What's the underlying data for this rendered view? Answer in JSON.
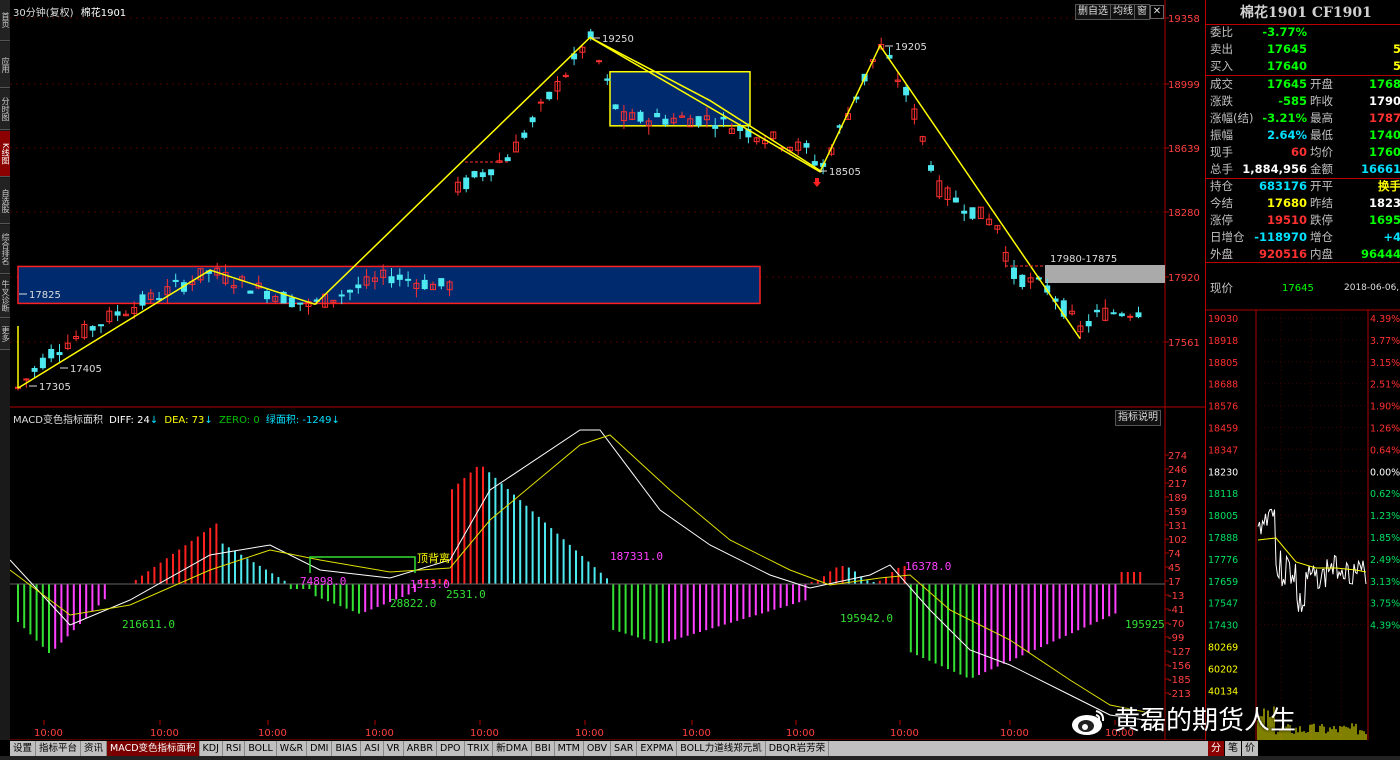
{
  "toolbar_left": [
    "首页",
    "应用",
    "分时图",
    "K线图",
    "自选股",
    "综合排名",
    "牛叉诊断",
    "更多"
  ],
  "chart": {
    "period_label": "30分钟(复权)",
    "symbol": "棉花1901",
    "buttons": [
      "删自选",
      "均线",
      "窗"
    ],
    "price_axis": [
      "19358",
      "18999",
      "18639",
      "18280",
      "17920",
      "17561"
    ],
    "annotations": {
      "hi1": "19250",
      "hi2": "19205",
      "lo1": "17305",
      "lo2": "17405",
      "lvl1": "17825",
      "lo3": "18505",
      "zone": "17980-17875"
    },
    "time_labels": [
      "10:00",
      "10:00",
      "10:00",
      "10:00",
      "10:00",
      "10:00",
      "10:00",
      "10:00",
      "10:00",
      "10:00",
      "10:00"
    ]
  },
  "macd": {
    "title": "MACD变色指标面积",
    "diff_label": "DIFF: 24",
    "dea_label": "DEA: 73",
    "zero_label": "ZERO: 0",
    "area_label": "绿面积: -1249",
    "help_button": "指标说明",
    "axis": [
      "274",
      "246",
      "217",
      "189",
      "159",
      "131",
      "102",
      "74",
      "45",
      "17",
      "-13",
      "-41",
      "-70",
      "-99",
      "-127",
      "-156",
      "-185",
      "-213"
    ],
    "area_labels": [
      "216611.0",
      "74898.0",
      "28822.0",
      "1513.0",
      "2531.0",
      "187331.0",
      "195942.0",
      "16378.0",
      "195925"
    ],
    "divergence_label": "顶背离"
  },
  "bottom_tabs": [
    "设置",
    "指标平台",
    "资讯",
    "MACD变色指标面积",
    "KDJ",
    "RSI",
    "BOLL",
    "W&R",
    "DMI",
    "BIAS",
    "ASI",
    "VR",
    "ARBR",
    "DPO",
    "TRIX",
    "新DMA",
    "BBI",
    "MTM",
    "OBV",
    "SAR",
    "EXPMA",
    "BOLL力道线郑元凯",
    "DBQR岩芳荣"
  ],
  "quote": {
    "title": "棉花1901 CF1901",
    "rows": [
      {
        "l": "委比",
        "v": "-3.77%",
        "vc": "#00ff00"
      },
      {
        "l": "卖出",
        "v": "17645",
        "vc": "#00ff00",
        "v2": "5",
        "v2c": "#ffff00"
      },
      {
        "l": "买入",
        "v": "17640",
        "vc": "#00ff00",
        "v2": "5",
        "v2c": "#ffff00"
      },
      {
        "l": "成交",
        "v": "17645",
        "vc": "#00ff00",
        "l2": "开盘",
        "v2": "1768",
        "v2c": "#00ff00"
      },
      {
        "l": "涨跌",
        "v": "-585",
        "vc": "#00ff00",
        "l2": "昨收",
        "v2": "1790",
        "v2c": "#ffffff"
      },
      {
        "l": "涨幅(结)",
        "v": "-3.21%",
        "vc": "#00ff00",
        "l2": "最高",
        "v2": "1787",
        "v2c": "#ff3030"
      },
      {
        "l": "振幅",
        "v": "2.64%",
        "vc": "#00e0ff",
        "l2": "最低",
        "v2": "1740",
        "v2c": "#00ff00"
      },
      {
        "l": "现手",
        "v": "60",
        "vc": "#ff3030",
        "l2": "均价",
        "v2": "1760",
        "v2c": "#00ff00"
      },
      {
        "l": "总手",
        "v": "1,884,956",
        "vc": "#ffffff",
        "l2": "金额",
        "v2": "16661",
        "v2c": "#00e0ff"
      },
      {
        "l": "持仓",
        "v": "683176",
        "vc": "#00e0ff",
        "l2": "开平",
        "v2": "换手",
        "v2c": "#ffff00"
      },
      {
        "l": "今结",
        "v": "17680",
        "vc": "#ffff00",
        "l2": "昨结",
        "v2": "1823",
        "v2c": "#ffffff"
      },
      {
        "l": "涨停",
        "v": "19510",
        "vc": "#ff3030",
        "l2": "跌停",
        "v2": "1695",
        "v2c": "#00ff00"
      },
      {
        "l": "日增仓",
        "v": "-118970",
        "vc": "#00e0ff",
        "l2": "增仓",
        "v2": "+4",
        "v2c": "#00e0ff"
      },
      {
        "l": "外盘",
        "v": "920516",
        "vc": "#ff3030",
        "l2": "内盘",
        "v2": "96444",
        "v2c": "#00ff00"
      }
    ],
    "now_label": "现价",
    "now_value": "17645",
    "now_date": "2018-06-06,",
    "mini_axis_left": [
      "19030",
      "18918",
      "18805",
      "18688",
      "18576",
      "18459",
      "18347",
      "18230",
      "18118",
      "18005",
      "17888",
      "17776",
      "17659",
      "17547",
      "17430",
      "80269",
      "60202",
      "40134"
    ],
    "mini_axis_right": [
      "4.39%",
      "3.77%",
      "3.15%",
      "2.51%",
      "1.90%",
      "1.26%",
      "0.64%",
      "0.00%",
      "0.62%",
      "1.23%",
      "1.85%",
      "2.49%",
      "3.13%",
      "3.75%",
      "4.39%"
    ],
    "mini_tabs": [
      "分",
      "笔",
      "价"
    ]
  },
  "watermark": "黄磊的期货人生"
}
